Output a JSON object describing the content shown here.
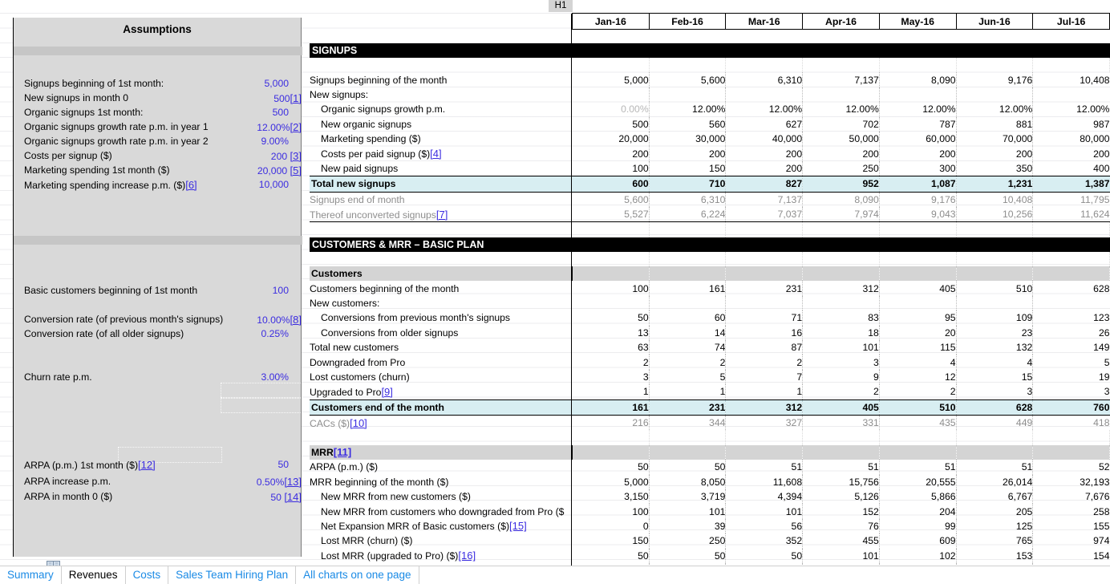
{
  "cell_reference": "H1",
  "assumptions": {
    "title": "Assumptions",
    "rows": [
      {
        "label": "Signups beginning of 1st month:",
        "value": "5,000",
        "footnote": ""
      },
      {
        "label": "New signups in month 0",
        "value": "500",
        "footnote": "[1]"
      },
      {
        "label": "Organic signups 1st month:",
        "value": "500",
        "footnote": ""
      },
      {
        "label": "Organic signups growth rate p.m. in year 1",
        "value": "12.00%",
        "footnote": "[2]"
      },
      {
        "label": "Organic signups growth rate p.m. in year 2",
        "value": "9.00%",
        "footnote": ""
      },
      {
        "label": "Costs per signup ($)",
        "value": "200",
        "footnote": "[3]"
      },
      {
        "label": "Marketing spending 1st month ($)",
        "value": "20,000",
        "footnote": "[5]"
      },
      {
        "label": "Marketing spending increase p.m. ($)",
        "value": "10,000",
        "footnote": "[6]",
        "footnote_on_label": true
      },
      {
        "label": "Basic customers beginning of 1st month",
        "value": "100",
        "footnote": ""
      },
      {
        "label": "Conversion rate (of previous month's signups)",
        "value": "10.00%",
        "footnote": "[8]"
      },
      {
        "label": "Conversion rate (of all older signups)",
        "value": "0.25%",
        "footnote": ""
      },
      {
        "label": "Churn rate p.m.",
        "value": "3.00%",
        "footnote": ""
      },
      {
        "label": "ARPA (p.m.) 1st month ($)",
        "value": "50",
        "footnote": "[12]",
        "footnote_on_label": true
      },
      {
        "label": "ARPA increase p.m.",
        "value": "0.50%",
        "footnote": "[13]"
      },
      {
        "label": "ARPA in month 0 ($)",
        "value": "50",
        "footnote": "[14]"
      }
    ]
  },
  "table": {
    "months": [
      "Jan-16",
      "Feb-16",
      "Mar-16",
      "Apr-16",
      "May-16",
      "Jun-16",
      "Jul-16"
    ],
    "sections": [
      {
        "title": "SIGNUPS",
        "rows": [
          {
            "label": "Signups beginning of the month",
            "values": [
              "5,000",
              "5,600",
              "6,310",
              "7,137",
              "8,090",
              "9,176",
              "10,408"
            ]
          },
          {
            "label": "New signups:",
            "values": [
              "",
              "",
              "",
              "",
              "",
              "",
              ""
            ]
          },
          {
            "label": "Organic signups growth p.m.",
            "indent": 1,
            "muted_first": true,
            "values": [
              "0.00%",
              "12.00%",
              "12.00%",
              "12.00%",
              "12.00%",
              "12.00%",
              "12.00%"
            ]
          },
          {
            "label": "New organic signups",
            "indent": 1,
            "values": [
              "500",
              "560",
              "627",
              "702",
              "787",
              "881",
              "987"
            ]
          },
          {
            "label": "Marketing spending ($)",
            "indent": 1,
            "values": [
              "20,000",
              "30,000",
              "40,000",
              "50,000",
              "60,000",
              "70,000",
              "80,000"
            ]
          },
          {
            "label": "Costs per paid signup ($)",
            "indent": 1,
            "footnote": "[4]",
            "values": [
              "200",
              "200",
              "200",
              "200",
              "200",
              "200",
              "200"
            ]
          },
          {
            "label": "New paid signups",
            "indent": 1,
            "values": [
              "100",
              "150",
              "200",
              "250",
              "300",
              "350",
              "400"
            ]
          },
          {
            "label": "Total new signups",
            "style": "total",
            "values": [
              "600",
              "710",
              "827",
              "952",
              "1,087",
              "1,231",
              "1,387"
            ]
          },
          {
            "label": "Signups end of month",
            "style": "muted",
            "values": [
              "5,600",
              "6,310",
              "7,137",
              "8,090",
              "9,176",
              "10,408",
              "11,795"
            ]
          },
          {
            "label": "Thereof unconverted signups",
            "style": "muted",
            "footnote": "[7]",
            "end_rule": true,
            "values": [
              "5,527",
              "6,224",
              "7,037",
              "7,974",
              "9,043",
              "10,256",
              "11,624"
            ]
          }
        ]
      },
      {
        "title": "CUSTOMERS & MRR – BASIC PLAN",
        "subsections": [
          {
            "heading": "Customers",
            "rows": [
              {
                "label": "Customers beginning of the month",
                "values": [
                  "100",
                  "161",
                  "231",
                  "312",
                  "405",
                  "510",
                  "628"
                ]
              },
              {
                "label": "New customers:",
                "values": [
                  "",
                  "",
                  "",
                  "",
                  "",
                  "",
                  ""
                ]
              },
              {
                "label": "Conversions from previous month's signups",
                "indent": 1,
                "values": [
                  "50",
                  "60",
                  "71",
                  "83",
                  "95",
                  "109",
                  "123"
                ]
              },
              {
                "label": "Conversions from older signups",
                "indent": 1,
                "values": [
                  "13",
                  "14",
                  "16",
                  "18",
                  "20",
                  "23",
                  "26"
                ]
              },
              {
                "label": "Total new customers",
                "values": [
                  "63",
                  "74",
                  "87",
                  "101",
                  "115",
                  "132",
                  "149"
                ]
              },
              {
                "label": "Downgraded from Pro",
                "values": [
                  "2",
                  "2",
                  "2",
                  "3",
                  "4",
                  "4",
                  "5"
                ]
              },
              {
                "label": "Lost customers (churn)",
                "values": [
                  "3",
                  "5",
                  "7",
                  "9",
                  "12",
                  "15",
                  "19"
                ]
              },
              {
                "label": "Upgraded to Pro",
                "footnote": "[9]",
                "values": [
                  "1",
                  "1",
                  "1",
                  "2",
                  "2",
                  "3",
                  "3"
                ]
              },
              {
                "label": "Customers end of the month",
                "style": "total",
                "values": [
                  "161",
                  "231",
                  "312",
                  "405",
                  "510",
                  "628",
                  "760"
                ]
              },
              {
                "label": "CACs ($)",
                "style": "muted",
                "footnote": "[10]",
                "values": [
                  "216",
                  "344",
                  "327",
                  "331",
                  "435",
                  "449",
                  "418"
                ]
              }
            ]
          },
          {
            "heading": "MRR",
            "heading_footnote": "[11]",
            "rows": [
              {
                "label": "ARPA (p.m.) ($)",
                "values": [
                  "50",
                  "50",
                  "51",
                  "51",
                  "51",
                  "51",
                  "52"
                ]
              },
              {
                "label": "MRR beginning of the month  ($)",
                "values": [
                  "5,000",
                  "8,050",
                  "11,608",
                  "15,756",
                  "20,555",
                  "26,014",
                  "32,193"
                ]
              },
              {
                "label": "New MRR from new customers ($)",
                "indent": 1,
                "values": [
                  "3,150",
                  "3,719",
                  "4,394",
                  "5,126",
                  "5,866",
                  "6,767",
                  "7,676"
                ]
              },
              {
                "label": "New MRR from customers who downgraded from Pro ($",
                "indent": 1,
                "values": [
                  "100",
                  "101",
                  "101",
                  "152",
                  "204",
                  "205",
                  "258"
                ]
              },
              {
                "label": "Net Expansion MRR of Basic customers ($)",
                "indent": 1,
                "footnote": "[15]",
                "values": [
                  "0",
                  "39",
                  "56",
                  "76",
                  "99",
                  "125",
                  "155"
                ]
              },
              {
                "label": "Lost MRR (churn) ($)",
                "indent": 1,
                "values": [
                  "150",
                  "250",
                  "352",
                  "455",
                  "609",
                  "765",
                  "974"
                ]
              },
              {
                "label": "Lost MRR (upgraded to Pro) ($)",
                "indent": 1,
                "footnote": "[16]",
                "values": [
                  "50",
                  "50",
                  "50",
                  "101",
                  "102",
                  "153",
                  "154"
                ]
              }
            ]
          }
        ]
      }
    ]
  },
  "sheet_tabs": [
    {
      "label": "Summary",
      "active": false
    },
    {
      "label": "Revenues",
      "active": true
    },
    {
      "label": "Costs",
      "active": false
    },
    {
      "label": "Sales Team Hiring Plan",
      "active": false
    },
    {
      "label": "All charts on one page",
      "active": false
    }
  ]
}
